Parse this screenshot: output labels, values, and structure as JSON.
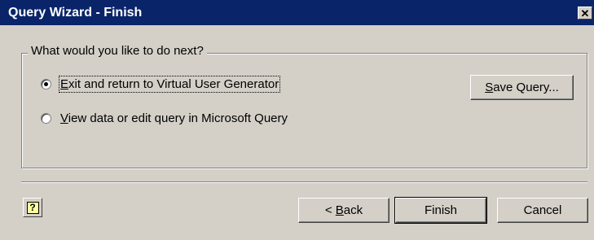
{
  "window": {
    "title": "Query Wizard - Finish",
    "close_glyph": "✕"
  },
  "group": {
    "legend": "What would you like to do next?",
    "options": [
      {
        "pre": "",
        "accel": "E",
        "post": "xit and return to Virtual User Generator",
        "checked": true
      },
      {
        "pre": "",
        "accel": "V",
        "post": "iew data or edit query in Microsoft Query",
        "checked": false
      }
    ]
  },
  "buttons": {
    "save_accel": "S",
    "save_rest": "ave Query...",
    "back_pre": "< ",
    "back_accel": "B",
    "back_rest": "ack",
    "finish": "Finish",
    "cancel": "Cancel",
    "help_glyph": "?"
  }
}
